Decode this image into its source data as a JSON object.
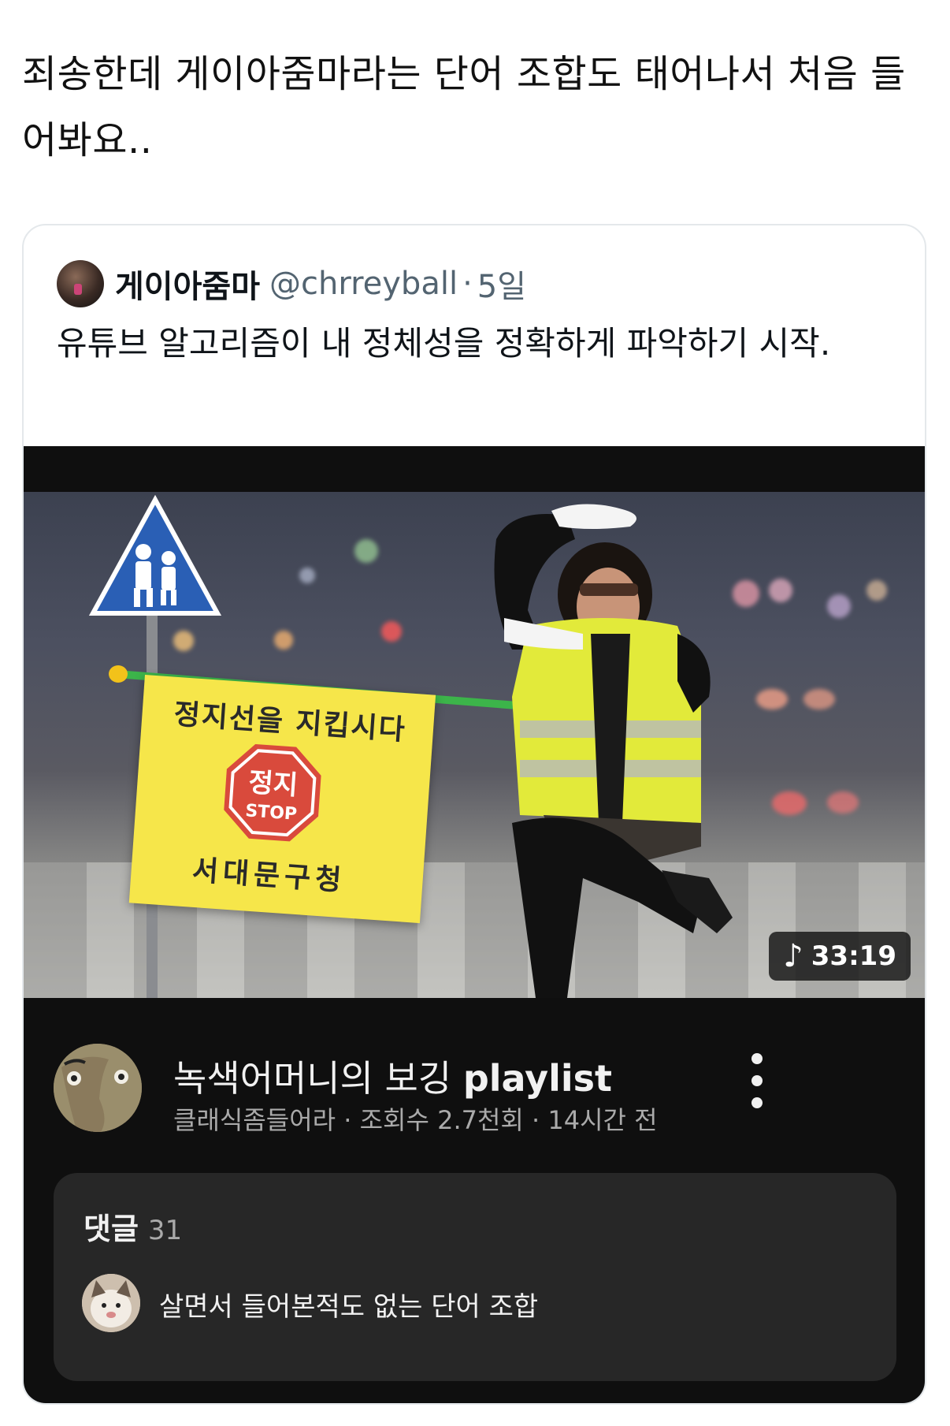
{
  "tweet": {
    "text": "죄송한데 게이아줌마라는 단어 조합도 태어나서 처음 들어봐요.."
  },
  "quote": {
    "author_name": "게이아줌마",
    "handle": "@chrreyball",
    "separator": "·",
    "time": "5일",
    "text": "유튜브 알고리즘이 내 정체성을 정확하게 파악하기 시작."
  },
  "video": {
    "thumbnail": {
      "flag_top_text": "정지선을 지킵시다",
      "stop_sign_korean": "정지",
      "stop_sign_english": "STOP",
      "flag_bottom_text": "서대문구청",
      "duration": "33:19",
      "duration_icon": "music-note-icon"
    },
    "title_korean": "녹색어머니의 보깅 ",
    "title_english": "playlist",
    "meta": "클래식좀들어라 · 조회수 2.7천회 · 14시간 전",
    "more_icon": "more-vertical-icon"
  },
  "comments": {
    "label": "댓글",
    "count": "31",
    "top_comment": "살면서 들어본적도 없는 단어 조합"
  },
  "colors": {
    "dark_bg": "#0f0f0f",
    "comment_box_bg": "#272727",
    "secondary_text": "#aaaaaa",
    "flag_yellow": "#f6e64a",
    "stop_red": "#d94a3c"
  }
}
